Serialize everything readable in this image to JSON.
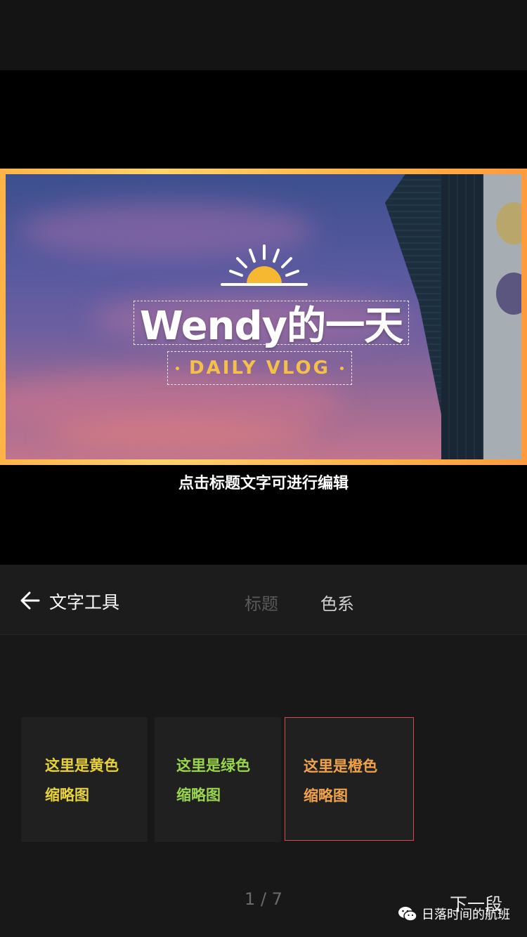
{
  "preview": {
    "title": "Wendy的一天",
    "subtitle": "DAILY VLOG",
    "hint": "点击标题文字可进行编辑"
  },
  "toolbar": {
    "back_icon": "arrow-left-icon",
    "title": "文字工具",
    "tabs": [
      {
        "label": "标题",
        "active": false
      },
      {
        "label": "色系",
        "active": true
      }
    ]
  },
  "cards": [
    {
      "line1": "这里是黄色",
      "line2": "缩略图",
      "color": "#e8d23a",
      "selected": false
    },
    {
      "line1": "这里是绿色",
      "line2": "缩略图",
      "color": "#9ad64a",
      "selected": false
    },
    {
      "line1": "这里是橙色",
      "line2": "缩略图",
      "color": "#f0a24a",
      "selected": true
    }
  ],
  "pager": {
    "text": "1 / 7"
  },
  "next_label": "下一段",
  "watermark": "日落时间的航班",
  "colors": {
    "frame": "#ffb347",
    "subtitle": "#f5c04a",
    "selected_border": "#d94a4a"
  }
}
